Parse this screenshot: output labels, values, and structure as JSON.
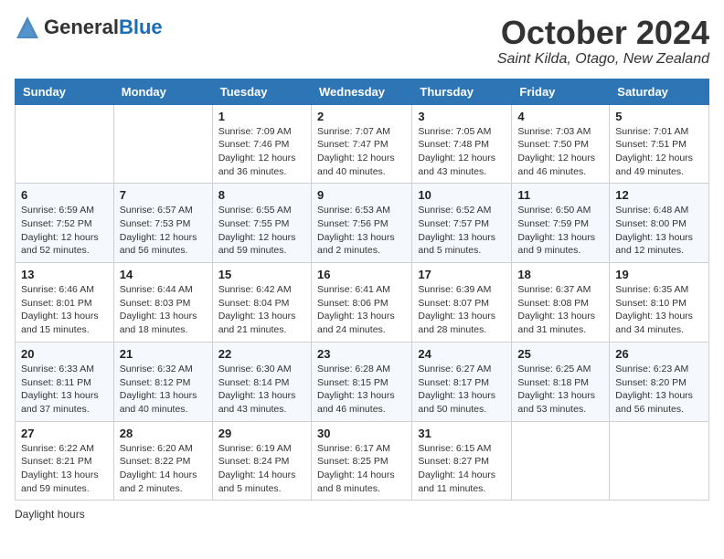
{
  "header": {
    "logo_general": "General",
    "logo_blue": "Blue",
    "month_title": "October 2024",
    "location": "Saint Kilda, Otago, New Zealand"
  },
  "days_of_week": [
    "Sunday",
    "Monday",
    "Tuesday",
    "Wednesday",
    "Thursday",
    "Friday",
    "Saturday"
  ],
  "weeks": [
    [
      {
        "day": "",
        "sunrise": "",
        "sunset": "",
        "daylight": ""
      },
      {
        "day": "",
        "sunrise": "",
        "sunset": "",
        "daylight": ""
      },
      {
        "day": "1",
        "sunrise": "Sunrise: 7:09 AM",
        "sunset": "Sunset: 7:46 PM",
        "daylight": "Daylight: 12 hours and 36 minutes."
      },
      {
        "day": "2",
        "sunrise": "Sunrise: 7:07 AM",
        "sunset": "Sunset: 7:47 PM",
        "daylight": "Daylight: 12 hours and 40 minutes."
      },
      {
        "day": "3",
        "sunrise": "Sunrise: 7:05 AM",
        "sunset": "Sunset: 7:48 PM",
        "daylight": "Daylight: 12 hours and 43 minutes."
      },
      {
        "day": "4",
        "sunrise": "Sunrise: 7:03 AM",
        "sunset": "Sunset: 7:50 PM",
        "daylight": "Daylight: 12 hours and 46 minutes."
      },
      {
        "day": "5",
        "sunrise": "Sunrise: 7:01 AM",
        "sunset": "Sunset: 7:51 PM",
        "daylight": "Daylight: 12 hours and 49 minutes."
      }
    ],
    [
      {
        "day": "6",
        "sunrise": "Sunrise: 6:59 AM",
        "sunset": "Sunset: 7:52 PM",
        "daylight": "Daylight: 12 hours and 52 minutes."
      },
      {
        "day": "7",
        "sunrise": "Sunrise: 6:57 AM",
        "sunset": "Sunset: 7:53 PM",
        "daylight": "Daylight: 12 hours and 56 minutes."
      },
      {
        "day": "8",
        "sunrise": "Sunrise: 6:55 AM",
        "sunset": "Sunset: 7:55 PM",
        "daylight": "Daylight: 12 hours and 59 minutes."
      },
      {
        "day": "9",
        "sunrise": "Sunrise: 6:53 AM",
        "sunset": "Sunset: 7:56 PM",
        "daylight": "Daylight: 13 hours and 2 minutes."
      },
      {
        "day": "10",
        "sunrise": "Sunrise: 6:52 AM",
        "sunset": "Sunset: 7:57 PM",
        "daylight": "Daylight: 13 hours and 5 minutes."
      },
      {
        "day": "11",
        "sunrise": "Sunrise: 6:50 AM",
        "sunset": "Sunset: 7:59 PM",
        "daylight": "Daylight: 13 hours and 9 minutes."
      },
      {
        "day": "12",
        "sunrise": "Sunrise: 6:48 AM",
        "sunset": "Sunset: 8:00 PM",
        "daylight": "Daylight: 13 hours and 12 minutes."
      }
    ],
    [
      {
        "day": "13",
        "sunrise": "Sunrise: 6:46 AM",
        "sunset": "Sunset: 8:01 PM",
        "daylight": "Daylight: 13 hours and 15 minutes."
      },
      {
        "day": "14",
        "sunrise": "Sunrise: 6:44 AM",
        "sunset": "Sunset: 8:03 PM",
        "daylight": "Daylight: 13 hours and 18 minutes."
      },
      {
        "day": "15",
        "sunrise": "Sunrise: 6:42 AM",
        "sunset": "Sunset: 8:04 PM",
        "daylight": "Daylight: 13 hours and 21 minutes."
      },
      {
        "day": "16",
        "sunrise": "Sunrise: 6:41 AM",
        "sunset": "Sunset: 8:06 PM",
        "daylight": "Daylight: 13 hours and 24 minutes."
      },
      {
        "day": "17",
        "sunrise": "Sunrise: 6:39 AM",
        "sunset": "Sunset: 8:07 PM",
        "daylight": "Daylight: 13 hours and 28 minutes."
      },
      {
        "day": "18",
        "sunrise": "Sunrise: 6:37 AM",
        "sunset": "Sunset: 8:08 PM",
        "daylight": "Daylight: 13 hours and 31 minutes."
      },
      {
        "day": "19",
        "sunrise": "Sunrise: 6:35 AM",
        "sunset": "Sunset: 8:10 PM",
        "daylight": "Daylight: 13 hours and 34 minutes."
      }
    ],
    [
      {
        "day": "20",
        "sunrise": "Sunrise: 6:33 AM",
        "sunset": "Sunset: 8:11 PM",
        "daylight": "Daylight: 13 hours and 37 minutes."
      },
      {
        "day": "21",
        "sunrise": "Sunrise: 6:32 AM",
        "sunset": "Sunset: 8:12 PM",
        "daylight": "Daylight: 13 hours and 40 minutes."
      },
      {
        "day": "22",
        "sunrise": "Sunrise: 6:30 AM",
        "sunset": "Sunset: 8:14 PM",
        "daylight": "Daylight: 13 hours and 43 minutes."
      },
      {
        "day": "23",
        "sunrise": "Sunrise: 6:28 AM",
        "sunset": "Sunset: 8:15 PM",
        "daylight": "Daylight: 13 hours and 46 minutes."
      },
      {
        "day": "24",
        "sunrise": "Sunrise: 6:27 AM",
        "sunset": "Sunset: 8:17 PM",
        "daylight": "Daylight: 13 hours and 50 minutes."
      },
      {
        "day": "25",
        "sunrise": "Sunrise: 6:25 AM",
        "sunset": "Sunset: 8:18 PM",
        "daylight": "Daylight: 13 hours and 53 minutes."
      },
      {
        "day": "26",
        "sunrise": "Sunrise: 6:23 AM",
        "sunset": "Sunset: 8:20 PM",
        "daylight": "Daylight: 13 hours and 56 minutes."
      }
    ],
    [
      {
        "day": "27",
        "sunrise": "Sunrise: 6:22 AM",
        "sunset": "Sunset: 8:21 PM",
        "daylight": "Daylight: 13 hours and 59 minutes."
      },
      {
        "day": "28",
        "sunrise": "Sunrise: 6:20 AM",
        "sunset": "Sunset: 8:22 PM",
        "daylight": "Daylight: 14 hours and 2 minutes."
      },
      {
        "day": "29",
        "sunrise": "Sunrise: 6:19 AM",
        "sunset": "Sunset: 8:24 PM",
        "daylight": "Daylight: 14 hours and 5 minutes."
      },
      {
        "day": "30",
        "sunrise": "Sunrise: 6:17 AM",
        "sunset": "Sunset: 8:25 PM",
        "daylight": "Daylight: 14 hours and 8 minutes."
      },
      {
        "day": "31",
        "sunrise": "Sunrise: 6:15 AM",
        "sunset": "Sunset: 8:27 PM",
        "daylight": "Daylight: 14 hours and 11 minutes."
      },
      {
        "day": "",
        "sunrise": "",
        "sunset": "",
        "daylight": ""
      },
      {
        "day": "",
        "sunrise": "",
        "sunset": "",
        "daylight": ""
      }
    ]
  ],
  "footer": {
    "daylight_hours_label": "Daylight hours"
  }
}
